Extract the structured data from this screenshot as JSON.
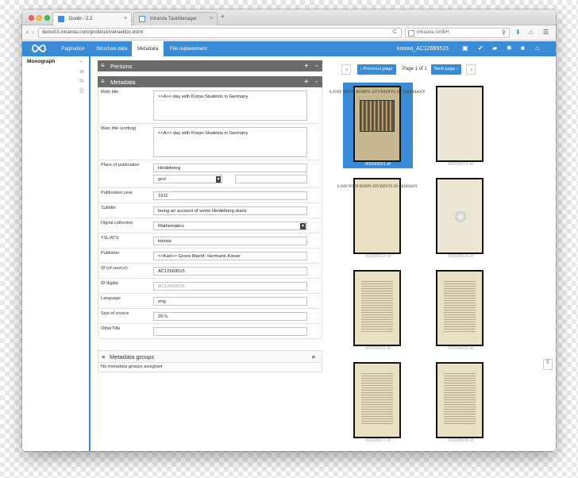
{
  "browser": {
    "tabs": [
      {
        "label": "Goobi - 2.2",
        "close": "×"
      },
      {
        "label": "intranda TaskManager",
        "close": "×"
      }
    ],
    "new_tab": "+",
    "url": "demo03.intranda.com/goobi/uii/metseditor.xhtml",
    "reload": "C",
    "search_placeholder": "intranda GmbH",
    "back": "‹",
    "forward": "›"
  },
  "appnav": {
    "items": [
      "Pagination",
      "Structure data",
      "Metadata",
      "File replacement"
    ],
    "active_index": 2,
    "record_id": "knowa_AC12669515"
  },
  "tree": {
    "root": "Monograph"
  },
  "persons": {
    "title": "Persons",
    "plus": "+",
    "minus": "-",
    "hamb": "≡"
  },
  "metadata": {
    "title": "Metadata",
    "plus": "+",
    "minus": "-",
    "hamb": "≡",
    "fields": [
      {
        "label": "Main title",
        "value": "<<A>> day with Korps-Students in Germany"
      },
      {
        "label": "Main title (sorting)",
        "value": "<<A>> day with Korps-Students in Germany"
      },
      {
        "label": "Place of publication",
        "value": "Heidelberg",
        "authority": "gnd"
      },
      {
        "label": "Publication year",
        "value": "1911"
      },
      {
        "label": "Subtitle",
        "value": "being an account of some Heidelberg duels"
      },
      {
        "label": "Digital collection",
        "value": "Mathematics"
      },
      {
        "label": "TSL/ATS",
        "value": "knowa"
      },
      {
        "label": "Publisher",
        "value": "<<Karl>> Groos Machf- Hermann Kieser"
      },
      {
        "label": "ID (of source)",
        "value": "AC12669515"
      },
      {
        "label": "ID digital",
        "value": "AC12669515"
      },
      {
        "label": "Language",
        "value": "eng"
      },
      {
        "label": "Size of source",
        "value": "20 S."
      },
      {
        "label": "OtherTitle",
        "value": ""
      }
    ]
  },
  "groups": {
    "title": "Metadata groups",
    "empty": "No metadata groups assigned",
    "hamb": "≡",
    "menu": "≡"
  },
  "pager": {
    "first": "«",
    "prev": "‹ Previous page",
    "info": "Page 1 of 1",
    "next": "Next page ›",
    "last": "»"
  },
  "thumbnails": [
    {
      "label": "00000001.tif",
      "caption": "A DAY WITH KORPS-STUDENTS IN GERMANY",
      "selected": true
    },
    {
      "label": "00000002.tif",
      "caption": ""
    },
    {
      "label": "00000003.tif",
      "caption": "A DAY WITH KORPS-STUDENTS IN GERMANY"
    },
    {
      "label": "00000004.tif",
      "caption": ""
    },
    {
      "label": "00000005.tif",
      "caption": ""
    },
    {
      "label": "00000006.tif",
      "caption": ""
    },
    {
      "label": "00000007.tif",
      "caption": ""
    },
    {
      "label": "00000008.tif",
      "caption": ""
    }
  ],
  "colors": {
    "accent": "#3a8bd5",
    "section_bar": "#6b6b6b"
  }
}
